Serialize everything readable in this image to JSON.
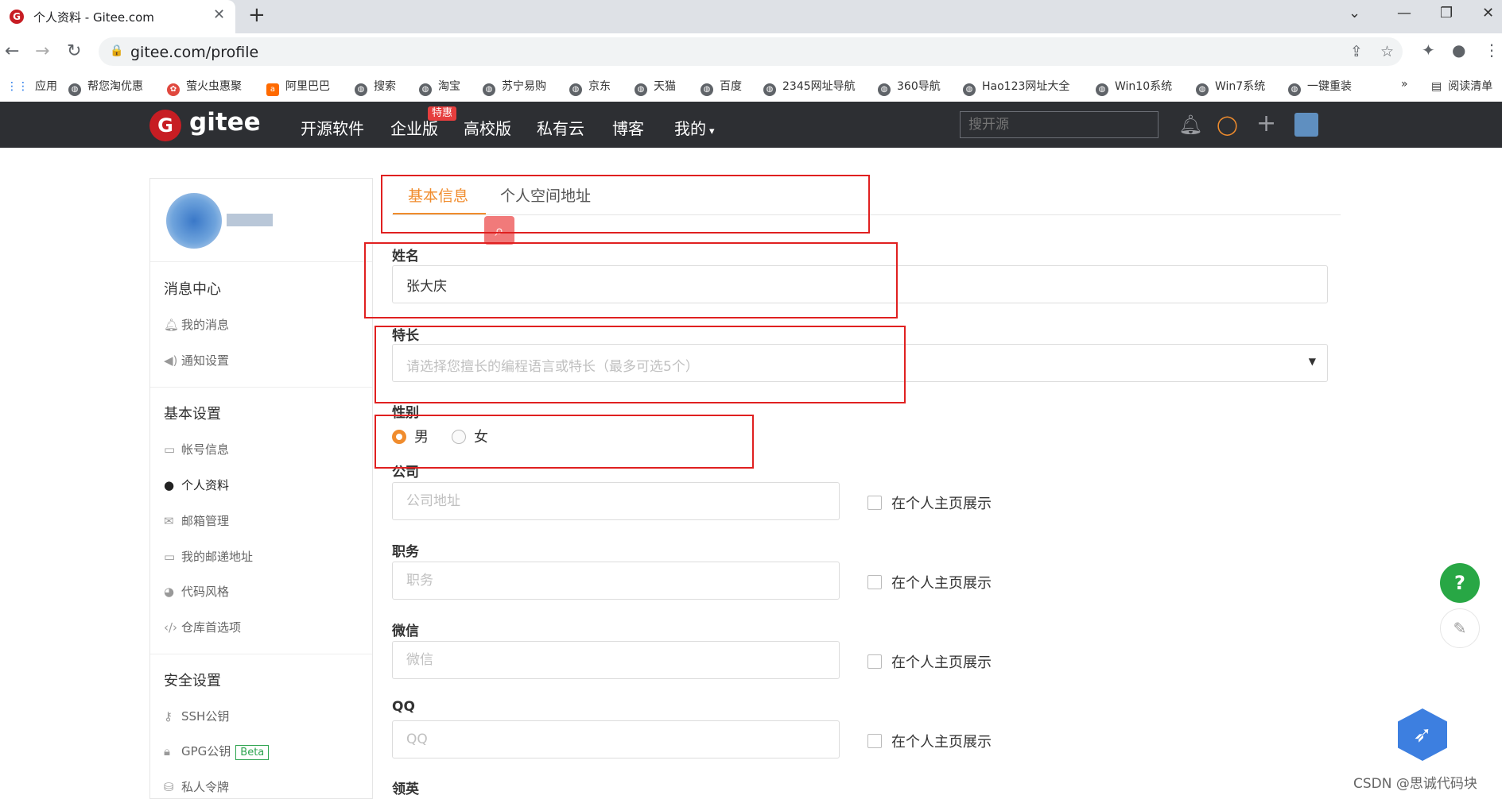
{
  "browser": {
    "tab_title": "个人资料 - Gitee.com",
    "tab_favicon": "G",
    "url": "gitee.com/profile",
    "bookmarks": [
      "应用",
      "帮您淘优惠",
      "萤火虫惠聚",
      "阿里巴巴",
      "搜索",
      "淘宝",
      "苏宁易购",
      "京东",
      "天猫",
      "百度",
      "2345网址导航",
      "360导航",
      "Hao123网址大全",
      "Win10系统",
      "Win7系统",
      "一键重装"
    ],
    "more": "»",
    "reading_list": "阅读清单"
  },
  "header": {
    "logo_letter": "G",
    "brand": "gitee",
    "nav": [
      "开源软件",
      "企业版",
      "高校版",
      "私有云",
      "博客",
      "我的"
    ],
    "badge": "特惠",
    "search_placeholder": "搜开源"
  },
  "sidebar": {
    "groups": [
      {
        "title": "消息中心",
        "items": [
          {
            "icon": "bell-icon",
            "label": "我的消息"
          },
          {
            "icon": "speaker-icon",
            "label": "通知设置"
          }
        ]
      },
      {
        "title": "基本设置",
        "items": [
          {
            "icon": "id-card-icon",
            "label": "帐号信息"
          },
          {
            "icon": "user-icon",
            "label": "个人资料",
            "active": true
          },
          {
            "icon": "mail-icon",
            "label": "邮箱管理"
          },
          {
            "icon": "id-card-icon",
            "label": "我的邮递地址"
          },
          {
            "icon": "palette-icon",
            "label": "代码风格"
          },
          {
            "icon": "code-icon",
            "label": "仓库首选项"
          }
        ]
      },
      {
        "title": "安全设置",
        "items": [
          {
            "icon": "key-icon",
            "label": "SSH公钥"
          },
          {
            "icon": "lock-icon",
            "label": "GPG公钥"
          },
          {
            "icon": "token-icon",
            "label": "私人令牌"
          }
        ]
      }
    ],
    "beta": "Beta"
  },
  "tabs": [
    "基本信息",
    "个人空间地址"
  ],
  "form": {
    "name_label": "姓名",
    "name_value": "张大庆",
    "skill_label": "特长",
    "skill_placeholder": "请选择您擅长的编程语言或特长（最多可选5个）",
    "gender_label": "性别",
    "gender_options": [
      "男",
      "女"
    ],
    "gender_selected": "男",
    "company_label": "公司",
    "company_placeholder": "公司地址",
    "title_label": "职务",
    "title_placeholder": "职务",
    "wechat_label": "微信",
    "wechat_placeholder": "微信",
    "qq_label": "QQ",
    "qq_placeholder": "QQ",
    "linkedin_label": "领英",
    "show_on_profile": "在个人主页展示"
  },
  "floating": {
    "help": "?"
  },
  "watermark": "CSDN @思诚代码块",
  "colors": {
    "accent": "#f08c2d",
    "header_bg": "#2d2f33",
    "brand_red": "#c71d23",
    "annotation": "#e02020",
    "help_green": "#28a745"
  }
}
